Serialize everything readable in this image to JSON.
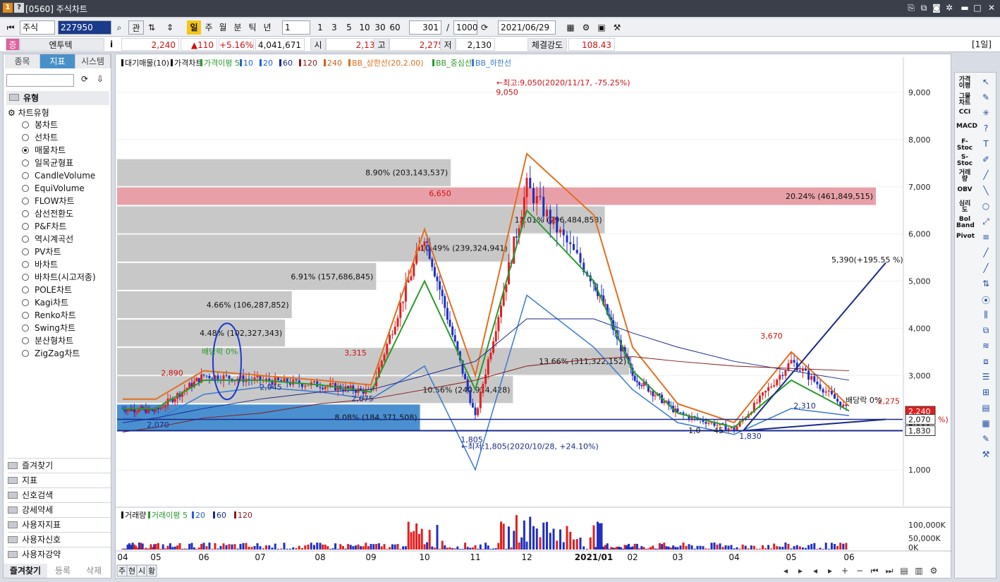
{
  "window": {
    "title": "[0560] 주식차트",
    "icon1": "1",
    "icon2": "?"
  },
  "toolbar": {
    "market": "주식",
    "code": "227950",
    "btn_gwan": "관",
    "periods": [
      "일",
      "주",
      "월",
      "분",
      "틱",
      "년"
    ],
    "interval_value": "1",
    "interval_presets": [
      "1",
      "3",
      "5",
      "10",
      "30",
      "60"
    ],
    "count": "301",
    "slash": "/",
    "total": "1000",
    "date": "2021/06/29"
  },
  "info": {
    "badge": "증",
    "name": "엔투텍",
    "i": "i",
    "price": "2,240",
    "change": "▲110",
    "rate": "+5.16%",
    "volume": "4,041,671",
    "open_label": "시",
    "open": "2,135",
    "high_label": "고",
    "high": "2,275",
    "low_label": "저",
    "low": "2,130",
    "strength_label": "체결강도",
    "strength": "108.43",
    "period_tag": "[1일]"
  },
  "left": {
    "tabs": [
      "종목",
      "지표",
      "시스템"
    ],
    "section_title": "유형",
    "tree_root": "차트유형",
    "chart_types": [
      "봉차트",
      "선차트",
      "매물차트",
      "일목균형표",
      "CandleVolume",
      "EquiVolume",
      "FLOW차트",
      "삼선전환도",
      "P&F차트",
      "역시계곡선",
      "PV차트",
      "바차트",
      "바차트(시고저종)",
      "POLE차트",
      "Kagi차트",
      "Renko차트",
      "Swing차트",
      "분산형차트",
      "ZigZag차트"
    ],
    "selected_index": 2,
    "folders": [
      "즐겨찾기",
      "지표",
      "신호검색",
      "강세약세",
      "사용자지표",
      "사용자신호",
      "사용자강약"
    ],
    "bottom_tabs": [
      "즐겨찾기",
      "등록",
      "삭제"
    ]
  },
  "legend_main": [
    "대기매물(10)",
    "가격차트",
    "가격이평 5",
    "10",
    "20",
    "60",
    "120",
    "240",
    "BB_상한선(20,2.00)",
    "BB_중심선",
    "BB_하한선"
  ],
  "legend_colors": [
    "#111111",
    "#111111",
    "#2a9a2a",
    "#2060d0",
    "#2060d0",
    "#1a2a8a",
    "#8a1a1a",
    "#d06020",
    "#e07020",
    "#2a9a2a",
    "#3a7ad0"
  ],
  "legend_volume": [
    "거래량",
    "거래이평 5",
    "20",
    "60",
    "120"
  ],
  "annotations": {
    "max_label": "←최고:9,050(2020/11/17, -75.25%)",
    "max_val": "9,050",
    "min_label": "←최저:1,805(2020/10/28, +24.10%)",
    "min_val": "1,805",
    "target": "5,390(+195.55 %)",
    "p6650": "6,650",
    "p3315": "3,315",
    "p2890": "2,890",
    "p2945": "2,945",
    "p2675": "2,675",
    "p2070": "2,070",
    "p3670": "3,670",
    "p2310": "2,310",
    "p1830": "1,830",
    "p2275": "2,275",
    "dividend1": "배당락 0%",
    "dividend2": "배당락 0%",
    "low1": "1,0",
    "low2": "45"
  },
  "volume_profile": [
    {
      "label": "8.90% (203,143,537)",
      "pct": 8.9
    },
    {
      "label": "20.24% (461,849,515)",
      "pct": 20.24
    },
    {
      "label": "13.01% (296,484,858)",
      "pct": 13.01
    },
    {
      "label": "10.49% (239,324,941)",
      "pct": 10.49
    },
    {
      "label": "6.91% (157,686,845)",
      "pct": 6.91
    },
    {
      "label": "4.66% (106,287,852)",
      "pct": 4.66
    },
    {
      "label": "4.48% (102,327,343)",
      "pct": 4.48
    },
    {
      "label": "13.66% (311,322,152)",
      "pct": 13.66
    },
    {
      "label": "10.56% (240,914,428)",
      "pct": 10.56
    },
    {
      "label": "8.08% (184,371,508)",
      "pct": 8.08
    }
  ],
  "price_axis": [
    "9,000",
    "8,000",
    "7,000",
    "6,000",
    "5,000",
    "4,000",
    "3,000",
    "2,000",
    "1,000"
  ],
  "price_tags": {
    "current": "2,240",
    "line1": "2,070",
    "line2": "1,830",
    "pct": "%)"
  },
  "volume_axis": [
    "100,000K",
    "50,000K",
    "0K"
  ],
  "date_axis": [
    "04",
    "05",
    "06",
    "07",
    "08",
    "09",
    "10",
    "11",
    "12",
    "2021/01",
    "02",
    "03",
    "04",
    "05",
    "06"
  ],
  "bottom_tabs": [
    "주",
    "현",
    "시",
    "황"
  ],
  "right_tools": [
    "가격이평",
    "그물차트",
    "CCI",
    "MACD",
    "F-Stoc",
    "S-Stoc",
    "거래량",
    "OBV",
    "심리도",
    "Bol Band",
    "Pivot"
  ],
  "chart_data": {
    "type": "candlestick",
    "xlabel": "",
    "ylabel": "",
    "ylim": [
      1000,
      9500
    ],
    "months": [
      "2020/04",
      "2020/05",
      "2020/06",
      "2020/07",
      "2020/08",
      "2020/09",
      "2020/10",
      "2020/11",
      "2020/12",
      "2021/01",
      "2021/02",
      "2021/03",
      "2021/04",
      "2021/05",
      "2021/06"
    ],
    "close_approx": [
      2300,
      2250,
      3000,
      2900,
      2800,
      2650,
      6000,
      2100,
      7000,
      5000,
      3000,
      2200,
      1850,
      3300,
      2240
    ],
    "high_approx": [
      2890,
      2500,
      3315,
      3100,
      3000,
      2800,
      6650,
      3100,
      9050,
      6900,
      3400,
      2500,
      2000,
      3670,
      2500
    ],
    "low_approx": [
      2070,
      2100,
      2700,
      2800,
      2600,
      2600,
      2800,
      1805,
      5200,
      3200,
      2800,
      1900,
      1830,
      2300,
      2130
    ],
    "volume_profile_pct": [
      8.9,
      20.24,
      13.01,
      10.49,
      6.91,
      4.66,
      4.48,
      13.66,
      10.56,
      8.08
    ],
    "legend": [
      "대기매물(10)",
      "가격차트",
      "가격이평 5",
      "10",
      "20",
      "60",
      "120",
      "240",
      "BB_상한선(20,2.00)",
      "BB_중심선",
      "BB_하한선"
    ]
  }
}
